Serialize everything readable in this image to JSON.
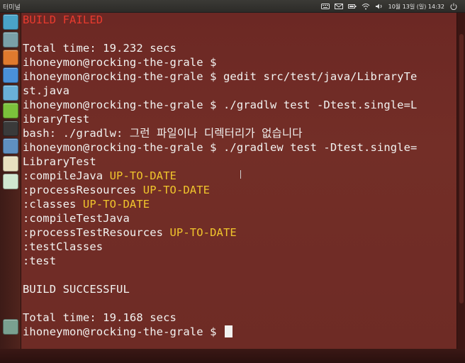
{
  "panel": {
    "title": "터미널",
    "clock": "10월 13일 (일) 14:32",
    "icons": [
      "keyboard-icon",
      "mail-icon",
      "battery-icon",
      "wifi-icon",
      "volume-icon",
      "power-icon"
    ]
  },
  "launcher": {
    "items": [
      {
        "name": "dash-home-icon",
        "color": "#4aa3c8"
      },
      {
        "name": "files-icon",
        "color": "#7aa0a8"
      },
      {
        "name": "firefox-icon",
        "color": "#e07a2e"
      },
      {
        "name": "chromium-icon",
        "color": "#4a90d9"
      },
      {
        "name": "settings-icon",
        "color": "#6ab0d8"
      },
      {
        "name": "notes-icon",
        "color": "#7cc23b"
      },
      {
        "name": "terminal-icon",
        "color": "#3a3a3a"
      },
      {
        "name": "system-tool-icon",
        "color": "#5f8fc0"
      },
      {
        "name": "document-icon",
        "color": "#e8e0c0"
      },
      {
        "name": "editor-icon",
        "color": "#d0e8d0"
      },
      {
        "name": "trash-icon",
        "color": "#7aa090"
      }
    ]
  },
  "terminal": {
    "colors": {
      "fg": "#f2f2f0",
      "red": "#e83a2e",
      "yellow": "#f0c52c"
    },
    "lines": [
      {
        "parts": [
          {
            "t": "BUILD FAILED",
            "c": "red"
          }
        ]
      },
      {
        "parts": []
      },
      {
        "parts": [
          {
            "t": "Total time: 19.232 secs"
          }
        ]
      },
      {
        "parts": [
          {
            "t": "ihoneymon@rocking-the-grale $"
          }
        ]
      },
      {
        "parts": [
          {
            "t": "ihoneymon@rocking-the-grale $ gedit src/test/java/LibraryTe"
          }
        ]
      },
      {
        "parts": [
          {
            "t": "st.java"
          }
        ]
      },
      {
        "parts": [
          {
            "t": "ihoneymon@rocking-the-grale $ ./gradlw test -Dtest.single=L"
          }
        ]
      },
      {
        "parts": [
          {
            "t": "ibraryTest"
          }
        ]
      },
      {
        "parts": [
          {
            "t": "bash: ./gradlw: 그런 파일이나 디렉터리가 없습니다"
          }
        ]
      },
      {
        "parts": [
          {
            "t": "ihoneymon@rocking-the-grale $ ./gradlew test -Dtest.single="
          }
        ]
      },
      {
        "parts": [
          {
            "t": "LibraryTest"
          }
        ]
      },
      {
        "parts": [
          {
            "t": ":compileJava "
          },
          {
            "t": "UP-TO-DATE",
            "c": "yellow"
          }
        ]
      },
      {
        "parts": [
          {
            "t": ":processResources "
          },
          {
            "t": "UP-TO-DATE",
            "c": "yellow"
          }
        ]
      },
      {
        "parts": [
          {
            "t": ":classes "
          },
          {
            "t": "UP-TO-DATE",
            "c": "yellow"
          }
        ]
      },
      {
        "parts": [
          {
            "t": ":compileTestJava"
          }
        ]
      },
      {
        "parts": [
          {
            "t": ":processTestResources "
          },
          {
            "t": "UP-TO-DATE",
            "c": "yellow"
          }
        ]
      },
      {
        "parts": [
          {
            "t": ":testClasses"
          }
        ]
      },
      {
        "parts": [
          {
            "t": ":test"
          }
        ]
      },
      {
        "parts": []
      },
      {
        "parts": [
          {
            "t": "BUILD SUCCESSFUL"
          }
        ]
      },
      {
        "parts": []
      },
      {
        "parts": [
          {
            "t": "Total time: 19.168 secs"
          }
        ]
      },
      {
        "parts": [
          {
            "t": "ihoneymon@rocking-the-grale $ "
          }
        ],
        "cursor": true
      }
    ]
  }
}
